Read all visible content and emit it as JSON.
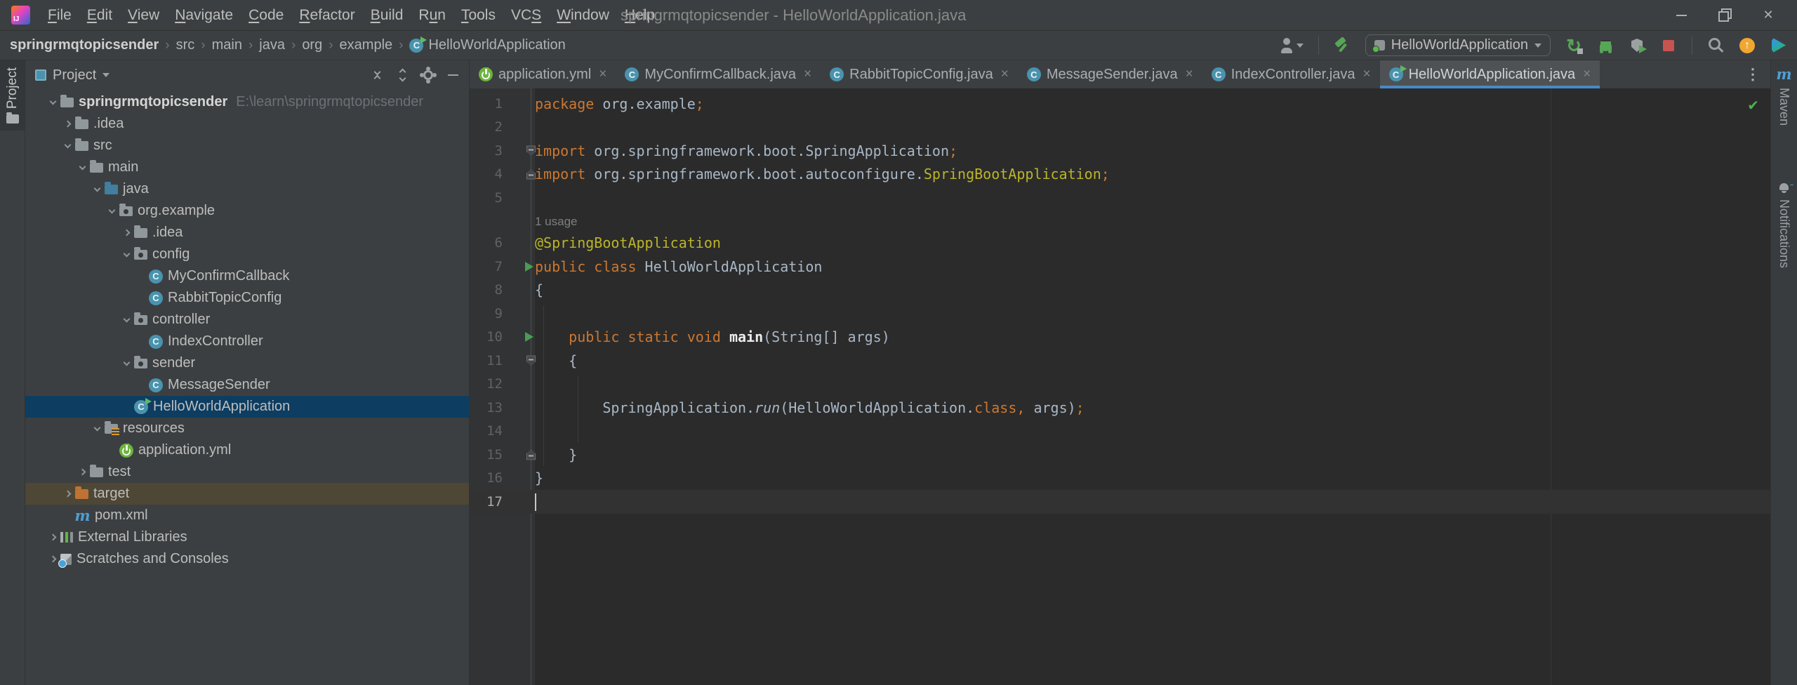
{
  "colors": {
    "accent": "#4A88C8",
    "selection": "#0D3D61",
    "excluded_row": "#4E4735",
    "keyword": "#CC7832",
    "plain_code": "#A9B7C6",
    "annotation": "#BBB529",
    "run_green": "#499C54",
    "stop_red": "#C75450",
    "editor_bg": "#2B2B2B",
    "panel_bg": "#3C3F41",
    "gutter_bg": "#313335",
    "spring_green": "#6DB33F",
    "class_icon": "#4A93AE",
    "maven_blue": "#4E9FD4",
    "update_orange": "#F0A732"
  },
  "icon_glyphs": {
    "class": "C",
    "class-run": "C",
    "maven": "m"
  },
  "window": {
    "logo_text": "IJ",
    "title": "springrmqtopicsender - HelloWorldApplication.java",
    "controls": [
      "minimize",
      "restore",
      "close"
    ]
  },
  "menubar": {
    "items": [
      {
        "label": "File",
        "mnemonic_index": 0
      },
      {
        "label": "Edit",
        "mnemonic_index": 0
      },
      {
        "label": "View",
        "mnemonic_index": 0
      },
      {
        "label": "Navigate",
        "mnemonic_index": 0
      },
      {
        "label": "Code",
        "mnemonic_index": 0
      },
      {
        "label": "Refactor",
        "mnemonic_index": 0
      },
      {
        "label": "Build",
        "mnemonic_index": 0
      },
      {
        "label": "Run",
        "mnemonic_index": 1
      },
      {
        "label": "Tools",
        "mnemonic_index": 0
      },
      {
        "label": "VCS",
        "mnemonic_index": 2
      },
      {
        "label": "Window",
        "mnemonic_index": 0
      },
      {
        "label": "Help",
        "mnemonic_index": 0
      }
    ]
  },
  "navbar": {
    "separator": "›",
    "breadcrumbs": [
      {
        "label": "springrmqtopicsender",
        "bold": true
      },
      {
        "label": "src"
      },
      {
        "label": "main"
      },
      {
        "label": "java"
      },
      {
        "label": "org"
      },
      {
        "label": "example"
      },
      {
        "label": "HelloWorldApplication",
        "icon": "class-run"
      }
    ],
    "run_config": "HelloWorldApplication",
    "tools_a": [
      "collaboration"
    ],
    "tools_b": [
      "build"
    ],
    "tools_c": [
      "rerun",
      "debug",
      "coverage",
      "stop"
    ],
    "tools_d": [
      "search",
      "update",
      "code-with-me"
    ]
  },
  "left_stripe": {
    "label": "Project"
  },
  "project": {
    "header": {
      "title": "Project",
      "actions": [
        "expand",
        "collapse",
        "settings",
        "hide"
      ]
    },
    "tree": [
      {
        "d": 0,
        "chev": "open",
        "icon": "folder",
        "label": "springrmqtopicsender",
        "bold": true,
        "hint": "E:\\learn\\springrmqtopicsender"
      },
      {
        "d": 1,
        "chev": "closed",
        "icon": "folder",
        "label": ".idea"
      },
      {
        "d": 1,
        "chev": "open",
        "icon": "folder",
        "label": "src"
      },
      {
        "d": 2,
        "chev": "open",
        "icon": "folder",
        "label": "main"
      },
      {
        "d": 3,
        "chev": "open",
        "icon": "folder-src",
        "label": "java"
      },
      {
        "d": 4,
        "chev": "open",
        "icon": "package",
        "label": "org.example"
      },
      {
        "d": 5,
        "chev": "closed",
        "icon": "folder",
        "label": ".idea"
      },
      {
        "d": 5,
        "chev": "open",
        "icon": "package",
        "label": "config"
      },
      {
        "d": 6,
        "icon": "class",
        "label": "MyConfirmCallback"
      },
      {
        "d": 6,
        "icon": "class",
        "label": "RabbitTopicConfig"
      },
      {
        "d": 5,
        "chev": "open",
        "icon": "package",
        "label": "controller"
      },
      {
        "d": 6,
        "icon": "class",
        "label": "IndexController"
      },
      {
        "d": 5,
        "chev": "open",
        "icon": "package",
        "label": "sender"
      },
      {
        "d": 6,
        "icon": "class",
        "label": "MessageSender"
      },
      {
        "d": 5,
        "icon": "class-run",
        "label": "HelloWorldApplication",
        "state": "selected"
      },
      {
        "d": 3,
        "chev": "open",
        "icon": "folder-res",
        "label": "resources"
      },
      {
        "d": 4,
        "icon": "spring",
        "label": "application.yml"
      },
      {
        "d": 2,
        "chev": "closed",
        "icon": "folder",
        "label": "test"
      },
      {
        "d": 1,
        "chev": "closed",
        "icon": "folder-excluded",
        "label": "target",
        "state": "excluded"
      },
      {
        "d": 1,
        "icon": "maven",
        "label": "pom.xml"
      },
      {
        "d": 0,
        "chev": "closed",
        "icon": "libs",
        "label": "External Libraries"
      },
      {
        "d": 0,
        "chev": "closed",
        "icon": "scratches",
        "label": "Scratches and Consoles"
      }
    ]
  },
  "editor_tabs": {
    "close_glyph": "×",
    "items": [
      {
        "icon": "spring",
        "label": "application.yml"
      },
      {
        "icon": "class",
        "label": "MyConfirmCallback.java"
      },
      {
        "icon": "class",
        "label": "RabbitTopicConfig.java"
      },
      {
        "icon": "class",
        "label": "MessageSender.java"
      },
      {
        "icon": "class",
        "label": "IndexController.java"
      },
      {
        "icon": "class-run",
        "label": "HelloWorldApplication.java",
        "active": true
      }
    ]
  },
  "editor": {
    "usage_hint": "1 usage",
    "lines": [
      {
        "n": 1,
        "tokens": [
          [
            "kw",
            "package"
          ],
          [
            "pl",
            " org.example"
          ],
          [
            "kw",
            ";"
          ]
        ]
      },
      {
        "n": 2,
        "tokens": []
      },
      {
        "n": 3,
        "gutter": "fold-top",
        "tokens": [
          [
            "kw",
            "import"
          ],
          [
            "pl",
            " org.springframework.boot.SpringApplication"
          ],
          [
            "kw",
            ";"
          ]
        ]
      },
      {
        "n": 4,
        "gutter": "fold-bottom",
        "tokens": [
          [
            "kw",
            "import"
          ],
          [
            "pl",
            " org.springframework.boot.autoconfigure."
          ],
          [
            "ann",
            "SpringBootApplication"
          ],
          [
            "kw",
            ";"
          ]
        ]
      },
      {
        "n": 5,
        "tokens": []
      },
      {
        "hint": true
      },
      {
        "n": 6,
        "tokens": [
          [
            "ann",
            "@SpringBootApplication"
          ]
        ]
      },
      {
        "n": 7,
        "gutter": "run",
        "tokens": [
          [
            "kw",
            "public class"
          ],
          [
            "pl",
            " HelloWorldApplication"
          ]
        ]
      },
      {
        "n": 8,
        "tokens": [
          [
            "pl",
            "{"
          ]
        ]
      },
      {
        "n": 9,
        "tokens": []
      },
      {
        "n": 10,
        "gutter": "run",
        "tokens": [
          [
            "pl",
            "    "
          ],
          [
            "kw",
            "public static void"
          ],
          [
            "decl",
            " main"
          ],
          [
            "pl",
            "(String[] args)"
          ]
        ]
      },
      {
        "n": 11,
        "gutter": "fold-top",
        "tokens": [
          [
            "pl",
            "    {"
          ]
        ]
      },
      {
        "n": 12,
        "tokens": []
      },
      {
        "n": 13,
        "tokens": [
          [
            "pl",
            "        SpringApplication."
          ],
          [
            "call",
            "run"
          ],
          [
            "pl",
            "(HelloWorldApplication."
          ],
          [
            "kw",
            "class"
          ],
          [
            "kw",
            ","
          ],
          [
            "pl",
            " args)"
          ],
          [
            "kw",
            ";"
          ]
        ]
      },
      {
        "n": 14,
        "tokens": []
      },
      {
        "n": 15,
        "gutter": "fold-bottom",
        "tokens": [
          [
            "pl",
            "    }"
          ]
        ]
      },
      {
        "n": 16,
        "tokens": [
          [
            "pl",
            "}"
          ]
        ]
      },
      {
        "n": 17,
        "caret": true,
        "tokens": []
      }
    ]
  },
  "right_stripe": {
    "items": [
      {
        "icon": "maven",
        "label": "Maven"
      },
      {
        "icon": "bell",
        "label": "Notifications"
      }
    ]
  }
}
